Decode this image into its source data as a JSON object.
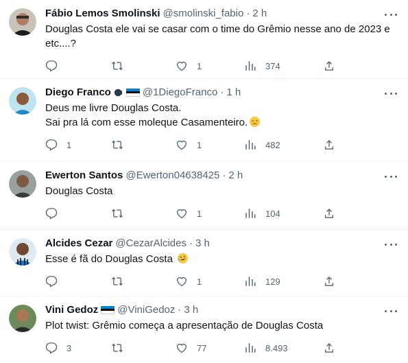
{
  "tweets": [
    {
      "name": "Fábio Lemos Smolinski",
      "handle": "@smolinski_fabio",
      "time": "2 h",
      "text": "Douglas Costa ele vai se casar com o time do Grêmio nesse ano de 2023 e etc....?",
      "replies": "",
      "retweets": "",
      "likes": "1",
      "views": "374"
    },
    {
      "name": "Diego Franco",
      "handle": "@1DiegoFranco",
      "time": "1 h",
      "text": "Deus me livre Douglas Costa.\nSai pra lá com esse moleque Casamenteiro.",
      "replies": "1",
      "retweets": "",
      "likes": "1",
      "views": "482"
    },
    {
      "name": "Ewerton Santos",
      "handle": "@Ewerton04638425",
      "time": "2 h",
      "text": "Douglas Costa",
      "replies": "",
      "retweets": "",
      "likes": "1",
      "views": "104"
    },
    {
      "name": "Alcides Cezar",
      "handle": "@CezarAlcides",
      "time": "3 h",
      "text": "Esse é fã do Douglas Costa",
      "replies": "",
      "retweets": "",
      "likes": "1",
      "views": "129"
    },
    {
      "name": "Vini Gedoz",
      "handle": "@ViniGedoz",
      "time": "3 h",
      "text": "Plot twist: Grêmio começa a apresentação de Douglas Costa",
      "replies": "3",
      "retweets": "",
      "likes": "77",
      "views": "8.493"
    }
  ],
  "separator": "·",
  "colors": {
    "text": "#0f1419",
    "muted": "#536471",
    "border": "#eff3f4",
    "flag_blue": "#0a7fd4",
    "flag_black": "#111111",
    "flag_white": "#ffffff"
  }
}
